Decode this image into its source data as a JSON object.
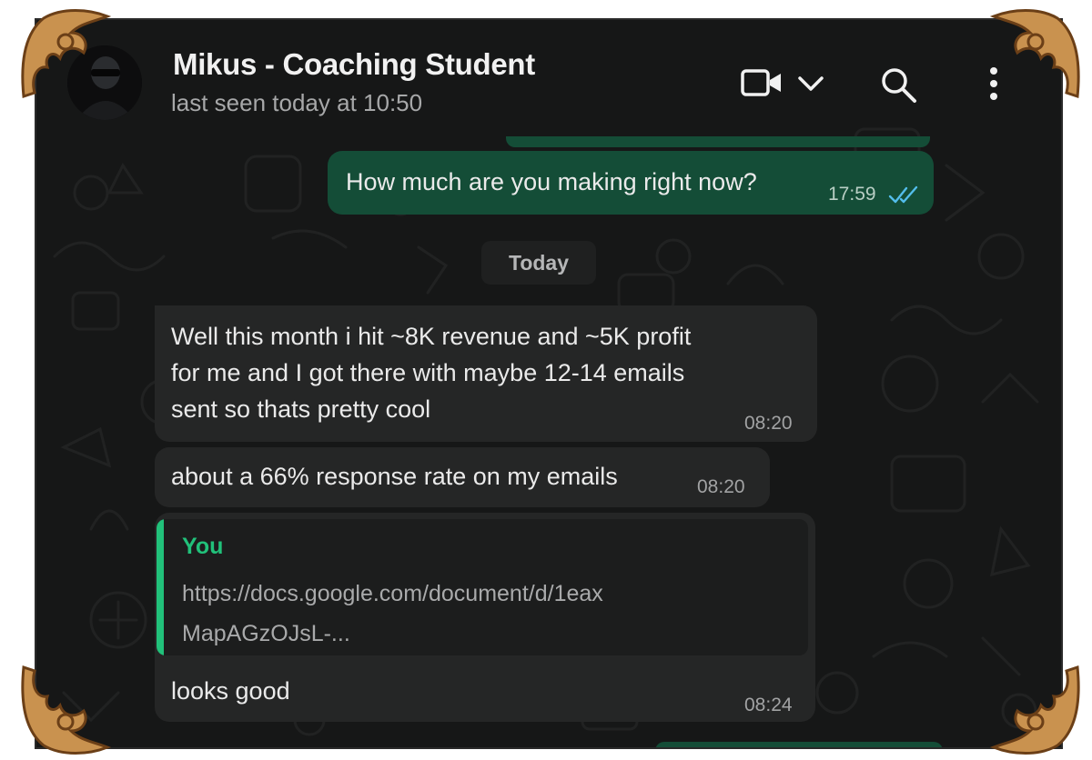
{
  "chat": {
    "contact_name": "Mikus - Coaching Student",
    "status": "last seen today at 10:50"
  },
  "icons": {
    "video": "video-call-icon",
    "dropdown": "chevron-down-icon",
    "search": "search-icon",
    "menu": "kebab-menu-icon",
    "ticks": "double-check-icon"
  },
  "messages": {
    "m1": {
      "text": "How much are you making right now?",
      "time": "17:59"
    },
    "date_separator": "Today",
    "m2": {
      "text": "Well this month i hit ~8K revenue and ~5K profit\nfor me and I got there with maybe 12-14 emails\nsent so thats pretty cool",
      "time": "08:20"
    },
    "m3": {
      "text": "about a 66% response rate on my emails",
      "time": "08:20"
    },
    "m4": {
      "quote_author": "You",
      "quote_text": "https://docs.google.com/document/d/1eax\nMapAGzOJsL-...",
      "text": "looks good",
      "time": "08:24"
    }
  },
  "colors": {
    "background": "#161717",
    "outgoing_bubble": "#144d37",
    "incoming_bubble": "#252626",
    "accent": "#21c17a",
    "read_ticks": "#53bdeb"
  }
}
